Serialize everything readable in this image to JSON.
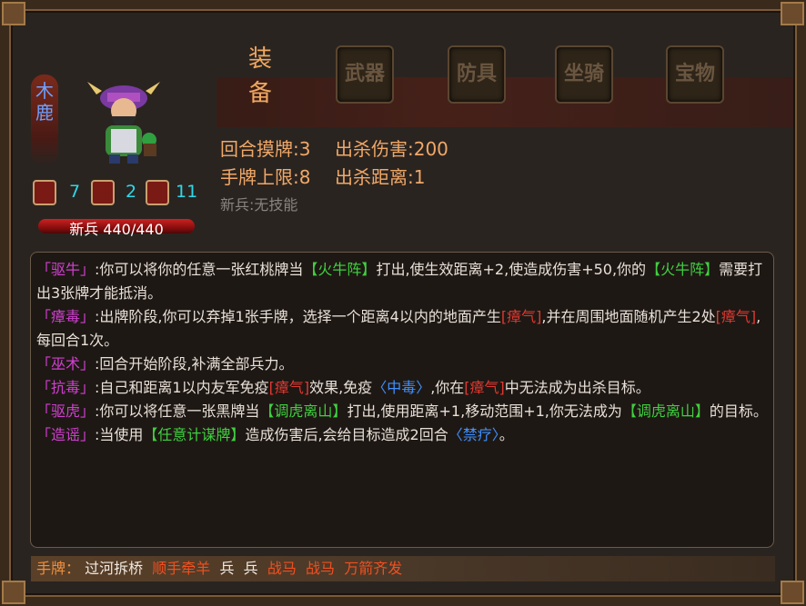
{
  "general": {
    "name": "木鹿"
  },
  "stats": {
    "hand_cards": "7",
    "attack": "2",
    "horse": "11"
  },
  "hp": {
    "text": "新兵 440/440"
  },
  "equip": {
    "title_line1": "装",
    "title_line2": "备",
    "slots": [
      "武器",
      "防具",
      "坐骑",
      "宝物"
    ]
  },
  "info": {
    "draw": "回合摸牌:3",
    "damage": "出杀伤害:200",
    "hand_limit": "手牌上限:8",
    "range": "出杀距离:1",
    "soldier": "新兵:无技能"
  },
  "skills": [
    {
      "name": "「驱牛」",
      "p1": ":你可以将你的任意一张红桃牌当",
      "t1": "【火牛阵】",
      "p2": "打出,使生效距离+2,使造成伤害+50,你的",
      "t2": "【火牛阵】",
      "p3": "需要打出3张牌才能抵消。"
    },
    {
      "name": "「瘴毒」",
      "p1": ":出牌阶段,你可以弃掉1张手牌，选择一个距离4以内的地面产生",
      "t1": "[瘴气]",
      "p2": ",并在周围地面随机产生2处",
      "t2": "[瘴气]",
      "p3": ",每回合1次。"
    },
    {
      "name": "「巫术」",
      "p1": ":回合开始阶段,补满全部兵力。"
    },
    {
      "name": "「抗毒」",
      "p1": ":自己和距离1以内友军免疫",
      "t1": "[瘴气]",
      "p2": "效果,免疫",
      "t2": "〈中毒〉",
      "p3": ",你在",
      "t3": "[瘴气]",
      "p4": "中无法成为出杀目标。"
    },
    {
      "name": "「驱虎」",
      "p1": ":你可以将任意一张黑牌当",
      "t1": "【调虎离山】",
      "p2": "打出,使用距离+1,移动范围+1,你无法成为",
      "t2": "【调虎离山】",
      "p3": "的目标。"
    },
    {
      "name": "「造谣」",
      "p1": ":当使用",
      "t1": "【任意计谋牌】",
      "p2": "造成伤害后,会给目标造成2回合",
      "t2": "〈禁疗〉",
      "p3": "。"
    }
  ],
  "hand": {
    "label": "手牌：",
    "cards": [
      "过河拆桥",
      "顺手牵羊",
      "兵",
      "兵",
      "战马",
      "战马",
      "万箭齐发"
    ]
  }
}
